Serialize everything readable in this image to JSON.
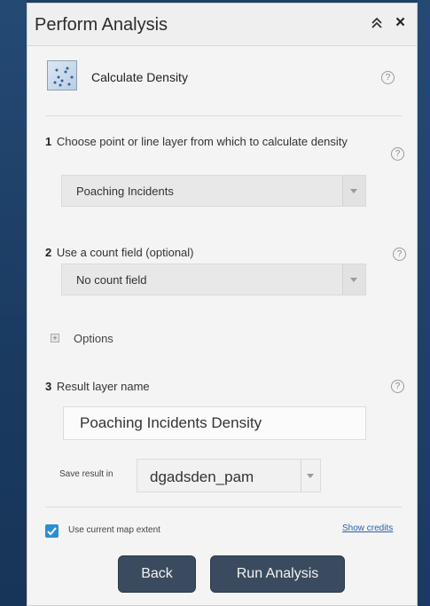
{
  "panel": {
    "title": "Perform Analysis",
    "collapse_icon": "double-chevron-up-icon",
    "close_icon": "close-icon",
    "close_glyph": "×"
  },
  "tool": {
    "name": "Calculate Density",
    "icon": "density-map-thumbnail"
  },
  "help_glyph": "?",
  "steps": {
    "step1": {
      "number": "1",
      "label": "Choose point or line layer from which to calculate density",
      "selected": "Poaching Incidents"
    },
    "step2": {
      "number": "2",
      "label": "Use a count field (optional)",
      "selected": "No count field"
    },
    "options": {
      "label": "Options",
      "toggle_glyph": "+"
    },
    "step3": {
      "number": "3",
      "label": "Result layer name",
      "value": "Poaching Incidents Density",
      "save_label": "Save result in",
      "save_selected": "dgadsden_pam"
    }
  },
  "footer": {
    "extent_label": "Use current map extent",
    "extent_checked": true,
    "credits_link": "Show credits",
    "back_label": "Back",
    "run_label": "Run Analysis"
  },
  "colors": {
    "background": "#1d3f66",
    "panel": "#f4f4f4",
    "button": "#3b4b5f",
    "checkbox": "#2c8fcf",
    "link": "#2a5fa8"
  }
}
